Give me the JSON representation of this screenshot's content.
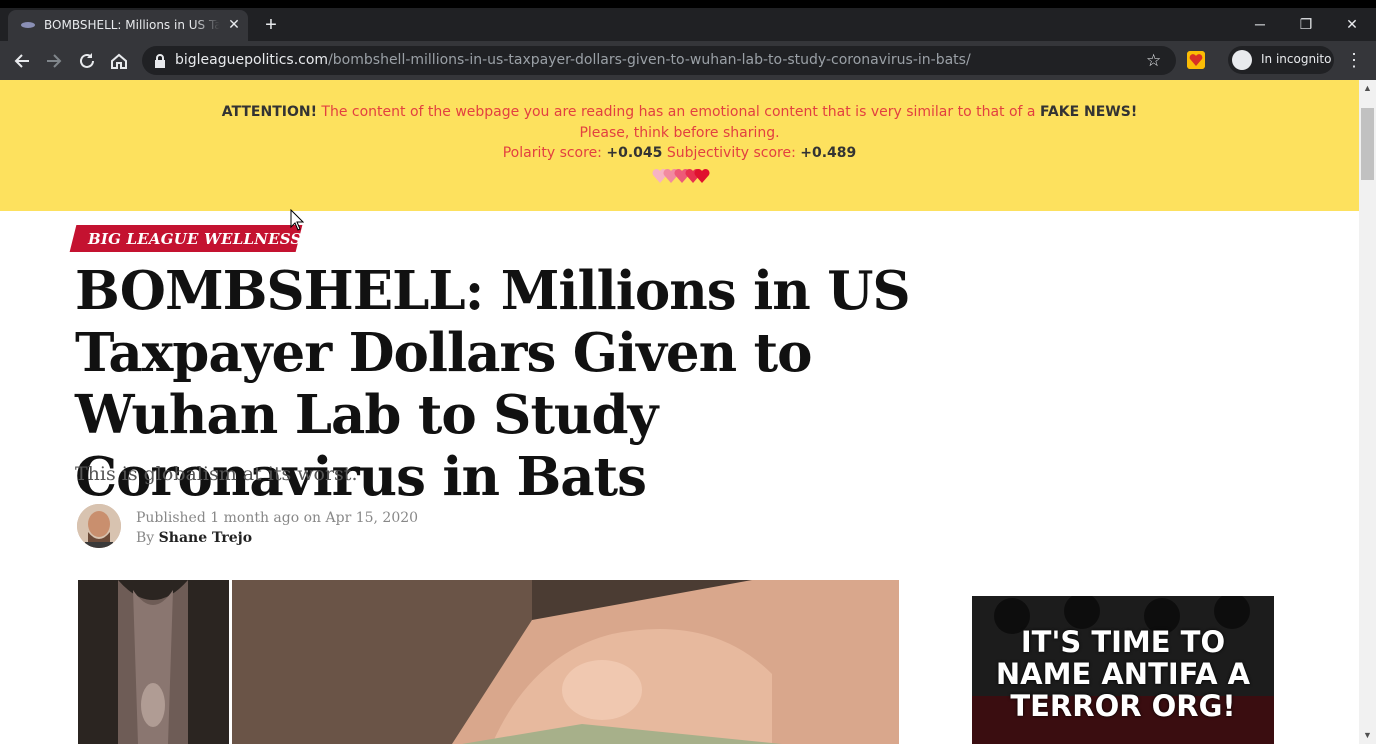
{
  "browser": {
    "tab_title": "BOMBSHELL: Millions in US Taxpayer Dollars Given to Wuhan Lab to Study Coronavirus in Bats",
    "url_host": "bigleaguepolitics.com",
    "url_path": "/bombshell-millions-in-us-taxpayer-dollars-given-to-wuhan-lab-to-study-coronavirus-in-bats/",
    "incognito_label": "In incognito"
  },
  "banner": {
    "attention": "ATTENTION!",
    "message": " The content of the webpage you are reading has an emotional content that is very similar to that of a ",
    "fake_news": "FAKE NEWS!",
    "line2": "Please, think before sharing.",
    "polarity_label": "Polarity score: ",
    "polarity_value": "+0.045",
    "subjectivity_label": " Subjectivity score: ",
    "subjectivity_value": "+0.489",
    "colors": {
      "background": "#fde15e",
      "text": "#e24040"
    }
  },
  "article": {
    "category": "BIG LEAGUE WELLNESS",
    "headline": "BOMBSHELL: Millions in US Taxpayer Dollars Given to Wuhan Lab to Study Coronavirus in Bats",
    "subhead": "This is globalism at its worst.",
    "published": "Published 1 month ago on Apr 15, 2020",
    "by": "By ",
    "author": "Shane Trejo"
  },
  "ad": {
    "text": "IT'S TIME TO NAME ANTIFA A TERROR ORG!"
  }
}
